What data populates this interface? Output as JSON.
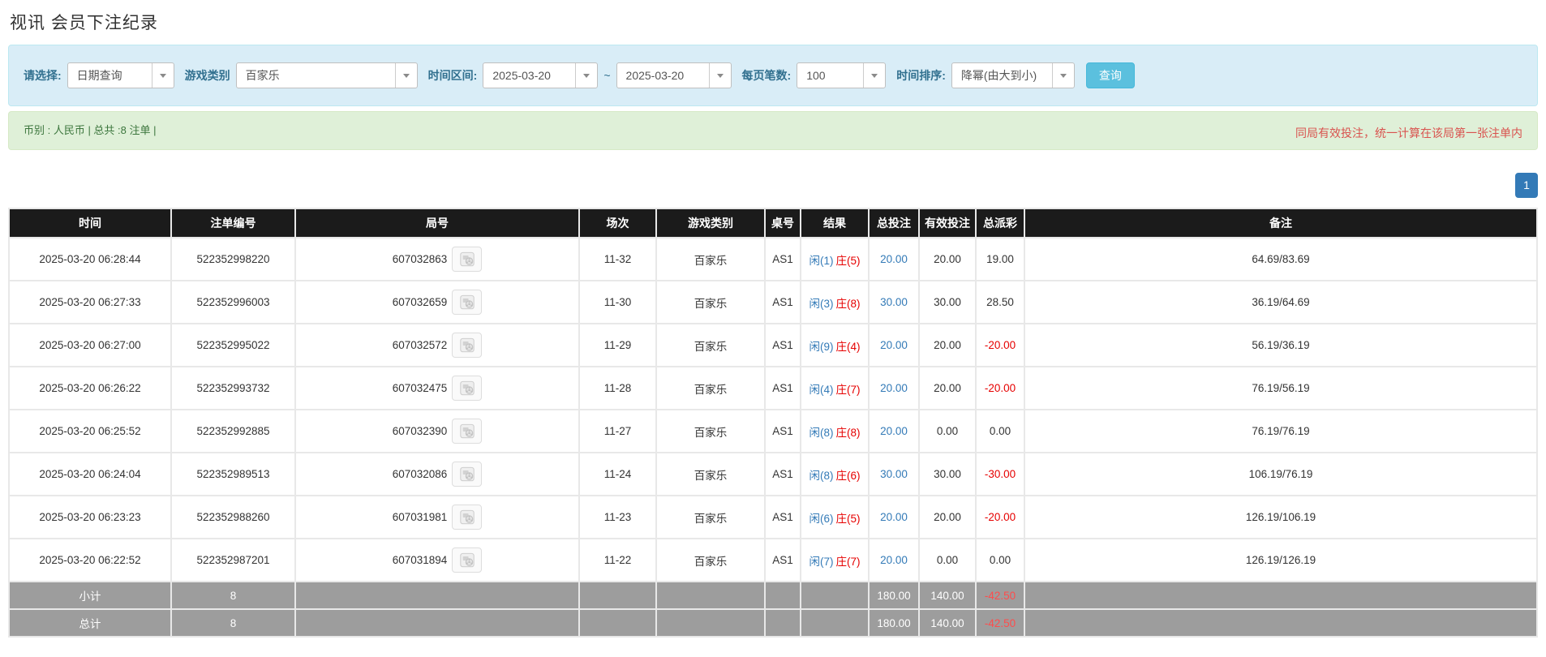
{
  "page_title": "视讯 会员下注纪录",
  "filters": {
    "select_label": "请选择:",
    "select_value": "日期查询",
    "game_type_label": "游戏类别",
    "game_type_value": "百家乐",
    "date_range_label": "时间区间:",
    "date_from": "2025-03-20",
    "date_separator": "~",
    "date_to": "2025-03-20",
    "page_size_label": "每页笔数:",
    "page_size_value": "100",
    "sort_label": "时间排序:",
    "sort_value": "降幂(由大到小)",
    "search_button": "查询"
  },
  "summary_bar": {
    "left_text": "币别 : 人民币 | 总共 :8 注单 |",
    "right_note": "同局有效投注，统一计算在该局第一张注单内"
  },
  "pagination": {
    "pages": [
      "1"
    ]
  },
  "table": {
    "headers": [
      "时间",
      "注单编号",
      "局号",
      "场次",
      "游戏类别",
      "桌号",
      "结果",
      "总投注",
      "有效投注",
      "总派彩",
      "备注"
    ],
    "rows": [
      {
        "time": "2025-03-20 06:28:44",
        "bet_id": "522352998220",
        "round_id": "607032863",
        "session": "11-32",
        "game": "百家乐",
        "table_no": "AS1",
        "result_player": "闲(1)",
        "result_banker": "庄(5)",
        "total_bet": "20.00",
        "valid_bet": "20.00",
        "payout": "19.00",
        "remark": "64.69/83.69"
      },
      {
        "time": "2025-03-20 06:27:33",
        "bet_id": "522352996003",
        "round_id": "607032659",
        "session": "11-30",
        "game": "百家乐",
        "table_no": "AS1",
        "result_player": "闲(3)",
        "result_banker": "庄(8)",
        "total_bet": "30.00",
        "valid_bet": "30.00",
        "payout": "28.50",
        "remark": "36.19/64.69"
      },
      {
        "time": "2025-03-20 06:27:00",
        "bet_id": "522352995022",
        "round_id": "607032572",
        "session": "11-29",
        "game": "百家乐",
        "table_no": "AS1",
        "result_player": "闲(9)",
        "result_banker": "庄(4)",
        "total_bet": "20.00",
        "valid_bet": "20.00",
        "payout": "-20.00",
        "remark": "56.19/36.19"
      },
      {
        "time": "2025-03-20 06:26:22",
        "bet_id": "522352993732",
        "round_id": "607032475",
        "session": "11-28",
        "game": "百家乐",
        "table_no": "AS1",
        "result_player": "闲(4)",
        "result_banker": "庄(7)",
        "total_bet": "20.00",
        "valid_bet": "20.00",
        "payout": "-20.00",
        "remark": "76.19/56.19"
      },
      {
        "time": "2025-03-20 06:25:52",
        "bet_id": "522352992885",
        "round_id": "607032390",
        "session": "11-27",
        "game": "百家乐",
        "table_no": "AS1",
        "result_player": "闲(8)",
        "result_banker": "庄(8)",
        "total_bet": "20.00",
        "valid_bet": "0.00",
        "payout": "0.00",
        "remark": "76.19/76.19"
      },
      {
        "time": "2025-03-20 06:24:04",
        "bet_id": "522352989513",
        "round_id": "607032086",
        "session": "11-24",
        "game": "百家乐",
        "table_no": "AS1",
        "result_player": "闲(8)",
        "result_banker": "庄(6)",
        "total_bet": "30.00",
        "valid_bet": "30.00",
        "payout": "-30.00",
        "remark": "106.19/76.19"
      },
      {
        "time": "2025-03-20 06:23:23",
        "bet_id": "522352988260",
        "round_id": "607031981",
        "session": "11-23",
        "game": "百家乐",
        "table_no": "AS1",
        "result_player": "闲(6)",
        "result_banker": "庄(5)",
        "total_bet": "20.00",
        "valid_bet": "20.00",
        "payout": "-20.00",
        "remark": "126.19/106.19"
      },
      {
        "time": "2025-03-20 06:22:52",
        "bet_id": "522352987201",
        "round_id": "607031894",
        "session": "11-22",
        "game": "百家乐",
        "table_no": "AS1",
        "result_player": "闲(7)",
        "result_banker": "庄(7)",
        "total_bet": "20.00",
        "valid_bet": "0.00",
        "payout": "0.00",
        "remark": "126.19/126.19"
      }
    ],
    "subtotal": {
      "label": "小计",
      "count": "8",
      "total_bet": "180.00",
      "valid_bet": "140.00",
      "payout": "-42.50"
    },
    "total": {
      "label": "总计",
      "count": "8",
      "total_bet": "180.00",
      "valid_bet": "140.00",
      "payout": "-42.50"
    }
  },
  "colors": {
    "filter_bar_bg": "#d9edf7",
    "filter_label_text": "#31708f",
    "search_button_bg": "#5bc0de",
    "summary_bar_bg": "#dff0d8",
    "summary_text_green": "#3c763d",
    "note_red": "#d9534f",
    "link_blue": "#337ab7",
    "player_blue": "#337ab7",
    "banker_red": "#e60000",
    "negative_red": "#e60000",
    "table_header_bg": "#1b1b1b",
    "summary_row_bg": "#9d9d9d",
    "pagination_bg": "#337ab7"
  }
}
